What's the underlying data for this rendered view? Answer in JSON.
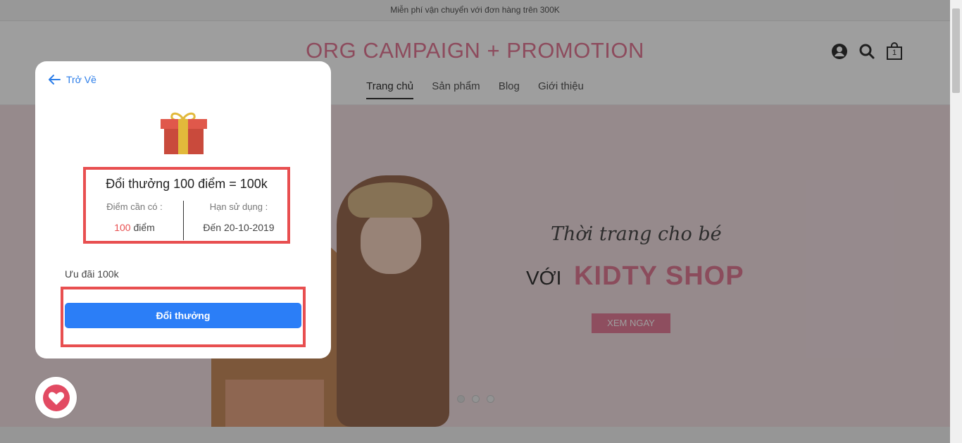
{
  "announcement": "Miễn phí vận chuyển với đơn hàng trên 300K",
  "site": {
    "logo": "ORG CAMPAIGN + PROMOTION",
    "cart_count": "1",
    "nav": [
      "Trang chủ",
      "Sản phẩm",
      "Blog",
      "Giới thiệu"
    ],
    "active_nav": "Trang chủ"
  },
  "hero": {
    "slogan": "Thời trang cho bé",
    "voi": "VỚI",
    "brand": "KIDTY SHOP",
    "cta": "XEM NGAY",
    "slides": 3,
    "active_slide": 1
  },
  "modal": {
    "back_label": "Trở Về",
    "reward_title": "Đổi thưởng 100 điểm = 100k",
    "points_label": "Điểm cần có :",
    "points_value": "100",
    "points_unit": "điểm",
    "expiry_label": "Hạn sử dụng :",
    "expiry_value": "Đến 20-10-2019",
    "description": "Ưu đãi 100k",
    "redeem_button": "Đổi thưởng"
  },
  "colors": {
    "accent_pink": "#e07b95",
    "button_blue": "#2b7ef7",
    "highlight_red": "#e84f50"
  }
}
